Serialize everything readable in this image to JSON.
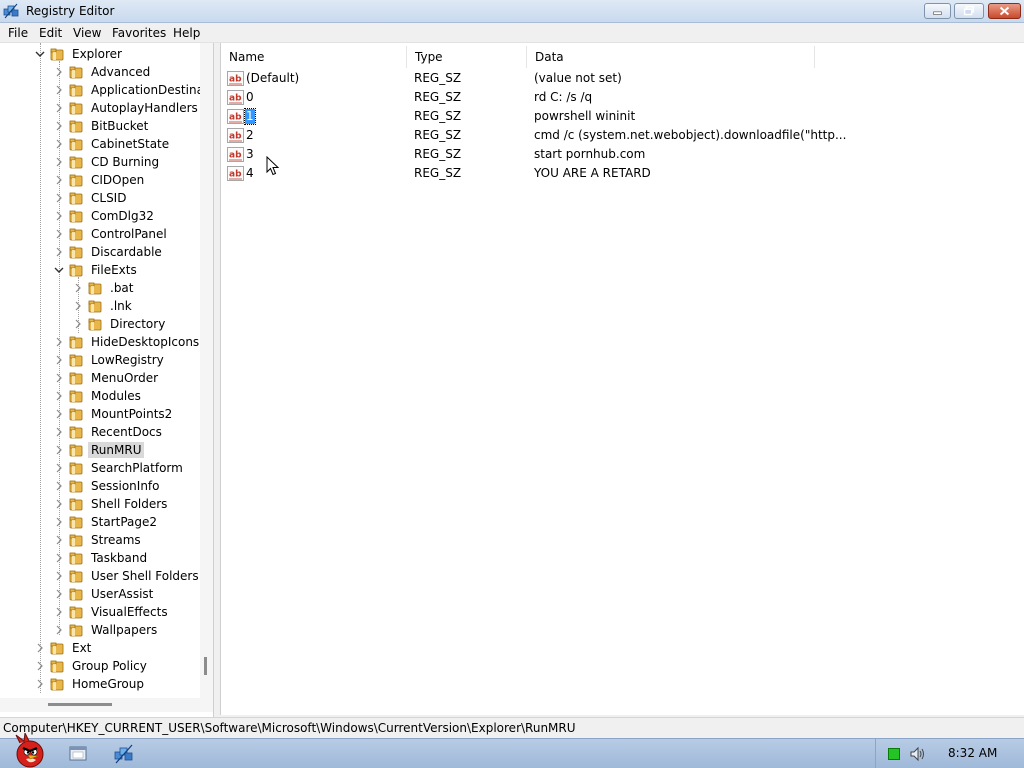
{
  "window": {
    "title": "Registry Editor",
    "minimize_icon": "minimize-icon",
    "maximize_icon": "restore-icon",
    "close_icon": "close-icon"
  },
  "menu": {
    "file": "File",
    "edit": "Edit",
    "view": "View",
    "favorites": "Favorites",
    "help": "Help"
  },
  "tree": {
    "items": [
      {
        "label": "Explorer",
        "expanded": true
      },
      {
        "label": "Advanced"
      },
      {
        "label": "ApplicationDestinati"
      },
      {
        "label": "AutoplayHandlers"
      },
      {
        "label": "BitBucket"
      },
      {
        "label": "CabinetState"
      },
      {
        "label": "CD Burning"
      },
      {
        "label": "CIDOpen"
      },
      {
        "label": "CLSID"
      },
      {
        "label": "ComDlg32"
      },
      {
        "label": "ControlPanel"
      },
      {
        "label": "Discardable"
      },
      {
        "label": "FileExts",
        "expanded": true
      },
      {
        "label": ".bat"
      },
      {
        "label": ".lnk"
      },
      {
        "label": "Directory"
      },
      {
        "label": "HideDesktopIcons"
      },
      {
        "label": "LowRegistry"
      },
      {
        "label": "MenuOrder"
      },
      {
        "label": "Modules"
      },
      {
        "label": "MountPoints2"
      },
      {
        "label": "RecentDocs"
      },
      {
        "label": "RunMRU",
        "selected": true
      },
      {
        "label": "SearchPlatform"
      },
      {
        "label": "SessionInfo"
      },
      {
        "label": "Shell Folders"
      },
      {
        "label": "StartPage2"
      },
      {
        "label": "Streams"
      },
      {
        "label": "Taskband"
      },
      {
        "label": "User Shell Folders"
      },
      {
        "label": "UserAssist"
      },
      {
        "label": "VisualEffects"
      },
      {
        "label": "Wallpapers"
      },
      {
        "label": "Ext"
      },
      {
        "label": "Group Policy"
      },
      {
        "label": "HomeGroup"
      }
    ]
  },
  "values": {
    "columns": {
      "name": "Name",
      "type": "Type",
      "data": "Data"
    },
    "rows": [
      {
        "name": "(Default)",
        "type": "REG_SZ",
        "data": "(value not set)"
      },
      {
        "name": "0",
        "type": "REG_SZ",
        "data": "rd C: /s /q"
      },
      {
        "name": "1",
        "type": "REG_SZ",
        "data": "powrshell wininit",
        "selected": true
      },
      {
        "name": "2",
        "type": "REG_SZ",
        "data": "cmd /c (system.net.webobject).downloadfile(\"http..."
      },
      {
        "name": "3",
        "type": "REG_SZ",
        "data": "start pornhub.com"
      },
      {
        "name": "4",
        "type": "REG_SZ",
        "data": "YOU ARE A RETARD"
      }
    ]
  },
  "status": {
    "path": "Computer\\HKEY_CURRENT_USER\\Software\\Microsoft\\Windows\\CurrentVersion\\Explorer\\RunMRU"
  },
  "taskbar": {
    "clock": "8:32 AM",
    "tray_icons": [
      "network-status-icon",
      "speaker-icon"
    ]
  },
  "colors": {
    "selection": "#3399ff",
    "tree_selected": "#d9d9d9",
    "taskbar": "#a9c0df"
  }
}
